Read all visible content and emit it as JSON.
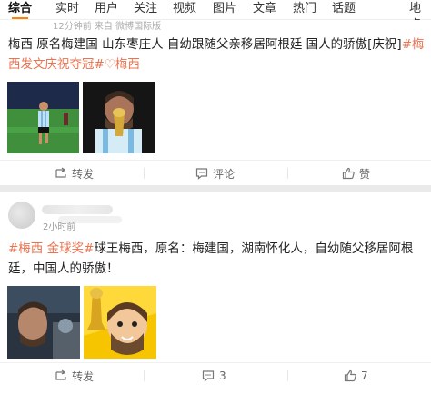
{
  "tabs": [
    "综合",
    "实时",
    "用户",
    "关注",
    "视频",
    "图片",
    "文章",
    "热门",
    "话题",
    "地点"
  ],
  "post1": {
    "meta": "12分钟前 来自 微博国际版",
    "text_line1_plain": "梅西 原名梅建国 山东枣庄人 自幼跟随父亲移居阿根廷 国人的骄傲[庆祝]",
    "text_line1_tag": "#梅",
    "text_line2_tag": "西发文庆祝夺冠#",
    "text_line2_link": "梅西",
    "actions": {
      "repost": "转发",
      "comment": "评论",
      "like": "赞"
    }
  },
  "post2": {
    "time": "2小时前",
    "tag1": "#梅西 金球奖#",
    "tag2": "球王梅西，",
    "text_line1_rest": "原名：梅建国，湖南怀化人，自幼随父移居阿根",
    "text_line2": "廷，中国人的骄傲！",
    "actions": {
      "repost": "转发",
      "comment": "3",
      "like": "7"
    }
  },
  "colors": {
    "accent": "#ff8200",
    "tag": "#eb7350"
  }
}
